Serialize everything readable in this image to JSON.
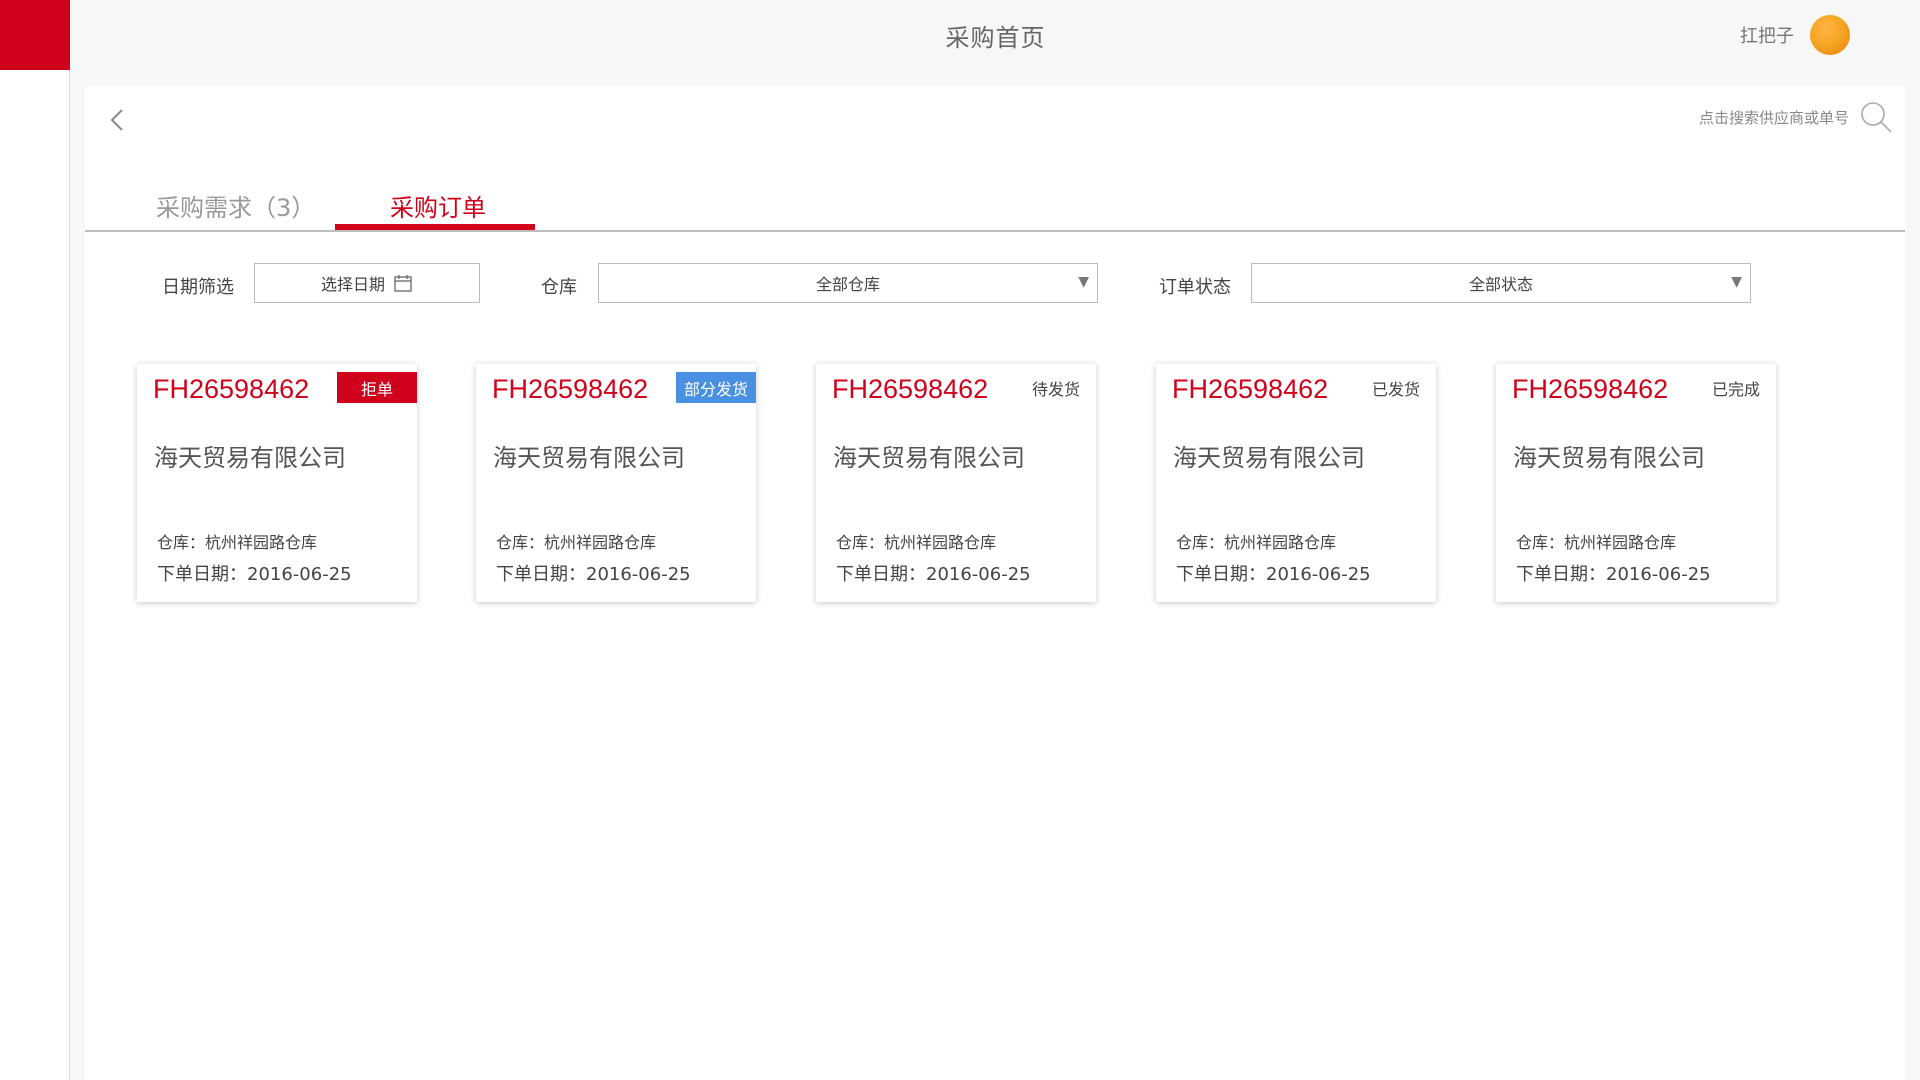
{
  "header": {
    "title": "采购首页",
    "user_name": "扛把子"
  },
  "toolbar": {
    "search_hint": "点击搜索供应商或单号"
  },
  "tabs": [
    {
      "label": "采购需求（3）",
      "active": false
    },
    {
      "label": "采购订单",
      "active": true
    }
  ],
  "filters": {
    "date_label": "日期筛选",
    "date_value": "选择日期",
    "warehouse_label": "仓库",
    "warehouse_value": "全部仓库",
    "status_label": "订单状态",
    "status_value": "全部状态"
  },
  "orders": [
    {
      "no": "FH26598462",
      "status": "拒单",
      "company": "海天贸易有限公司",
      "warehouse": "仓库：杭州祥园路仓库",
      "date": "下单日期：2016-06-25"
    },
    {
      "no": "FH26598462",
      "status": "部分发货",
      "company": "海天贸易有限公司",
      "warehouse": "仓库：杭州祥园路仓库",
      "date": "下单日期：2016-06-25"
    },
    {
      "no": "FH26598462",
      "status": "待发货",
      "company": "海天贸易有限公司",
      "warehouse": "仓库：杭州祥园路仓库",
      "date": "下单日期：2016-06-25"
    },
    {
      "no": "FH26598462",
      "status": "已发货",
      "company": "海天贸易有限公司",
      "warehouse": "仓库：杭州祥园路仓库",
      "date": "下单日期：2016-06-25"
    },
    {
      "no": "FH26598462",
      "status": "已完成",
      "company": "海天贸易有限公司",
      "warehouse": "仓库：杭州祥园路仓库",
      "date": "下单日期：2016-06-25"
    }
  ],
  "colors": {
    "brand_red": "#d0021b",
    "badge_blue": "#4a90e2",
    "avatar_orange": "#f5a623"
  },
  "icons": [
    "back-chevron-icon",
    "search-icon",
    "calendar-icon",
    "dropdown-arrow-icon"
  ]
}
